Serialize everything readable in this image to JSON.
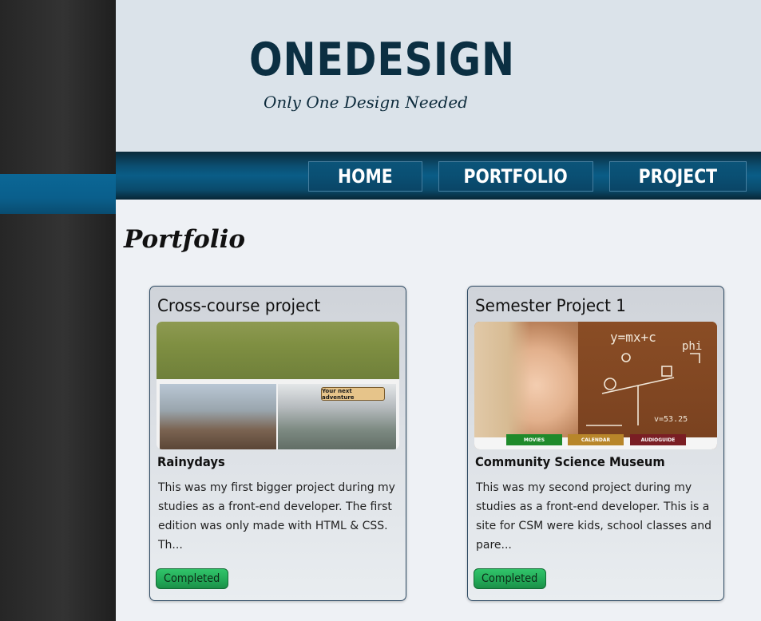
{
  "brand": {
    "logo": "ONEDESIGN",
    "tagline": "Only One Design Needed"
  },
  "nav": {
    "items": [
      {
        "label": "HOME"
      },
      {
        "label": "PORTFOLIO"
      },
      {
        "label": "PROJECT"
      }
    ]
  },
  "page": {
    "title": "Portfolio"
  },
  "cards": [
    {
      "title": "Cross-course project",
      "subtitle": "Rainydays",
      "description": "This was my first bigger project during my studies as a front-end developer. The first edition was only made with HTML & CSS. Th...",
      "status": "Completed",
      "image": {
        "overlay_text": "Your next adventure"
      }
    },
    {
      "title": "Semester Project 1",
      "subtitle": "Community Science Museum",
      "description": "This was my second project during my studies as a front-end developer. This is a site for CSM were kids, school classes and pare...",
      "status": "Completed",
      "image": {
        "buttons": [
          "MOVIES",
          "CALENDAR",
          "AUDIOGUIDE"
        ]
      }
    }
  ],
  "colors": {
    "sidebar": "#2b2b2b",
    "sidebar_accent": "#0a6392",
    "header_bg": "#dbe3ea",
    "logo": "#0b2f42",
    "nav_bg": "#0a4f73",
    "status_badge": "#27b35f"
  }
}
